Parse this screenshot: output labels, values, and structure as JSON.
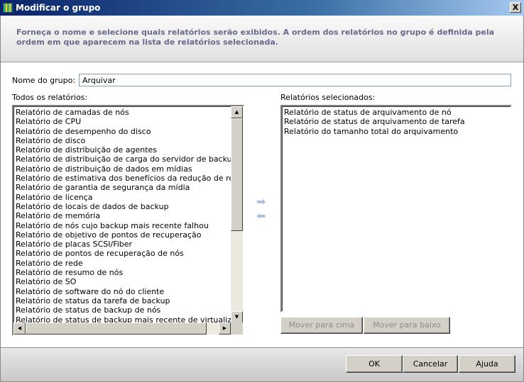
{
  "window": {
    "title": "Modificar o grupo",
    "close": "X"
  },
  "header": {
    "description": "Forneça o nome e selecione quais relatórios serão exibidos. A ordem dos relatórios no grupo é definida pela ordem em que aparecem na lista de relatórios selecionada."
  },
  "form": {
    "name_label": "Nome do grupo:",
    "name_value": "Arquivar",
    "all_label": "Todos os relatórios:",
    "selected_label": "Relatórios selecionados:"
  },
  "all_reports": [
    "Relatório de camadas de nós",
    "Relatório de CPU",
    "Relatório de desempenho do disco",
    "Relatório de disco",
    "Relatório de distribuição de agentes",
    "Relatório de distribuição de carga do servidor de backup",
    "Relatório de distribuição de dados em mídias",
    "Relatório de estimativa dos benefícios da redução de redundância",
    "Relatório de garantia de segurança da mídia",
    "Relatório de licença",
    "Relatório de locais de dados de backup",
    "Relatório de memória",
    "Relatório de nós cujo backup mais recente falhou",
    "Relatório de objetivo de pontos de recuperação",
    "Relatório de placas SCSI/Fiber",
    "Relatório de pontos de recuperação de nós",
    "Relatório de rede",
    "Relatório de resumo de nós",
    "Relatório de SO",
    "Relatório de software do nó do cliente",
    "Relatório de status da tarefa de backup",
    "Relatório de status de backup de nós",
    "Relatório de status de backup mais recente de virtualização"
  ],
  "selected_reports": [
    "Relatório de status de arquivamento de nó",
    "Relatório de status de arquivamento de tarefa",
    "Relatório do tamanho total do arquivamento"
  ],
  "buttons": {
    "move_up": "Mover para cima",
    "move_down": "Mover para baixo",
    "ok": "OK",
    "cancel": "Cancelar",
    "help": "Ajuda"
  }
}
